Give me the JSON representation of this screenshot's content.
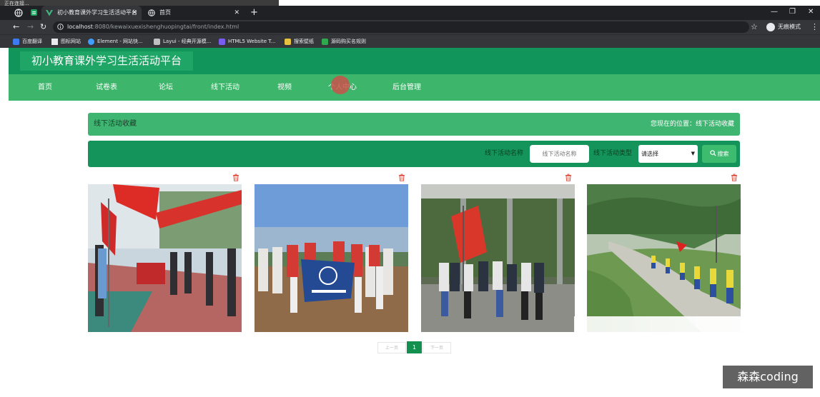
{
  "browser": {
    "status_text": "正在连接...",
    "tabs": [
      {
        "title": "初小教育课外学习生活活动平台",
        "active": true
      },
      {
        "title": "首页",
        "active": false
      }
    ],
    "url_host": "localhost",
    "url_path": ":8080/kewaixuexishenghuopingtai/front/index.html",
    "incognito_label": "无痕模式",
    "bookmarks": [
      "百度翻译",
      "图标网站",
      "Element - 网站快...",
      "Layui - 经典开源模...",
      "HTML5 Website T...",
      "搜索壁纸",
      "源码购买名规则"
    ]
  },
  "site": {
    "title": "初小教育课外学习生活活动平台",
    "nav": [
      "首页",
      "试卷表",
      "论坛",
      "线下活动",
      "视频",
      "个人中心",
      "后台管理"
    ]
  },
  "breadcrumb": {
    "title": "线下活动收藏",
    "location": "您现在的位置：线下活动收藏"
  },
  "search": {
    "name_label": "线下活动名称",
    "name_placeholder": "线下活动名称",
    "type_label": "线下活动类型",
    "select_value": "请选择",
    "button_label": "搜索"
  },
  "cards": [
    {
      "image": "campus-event-red-flags"
    },
    {
      "image": "baseball-team-group-photo"
    },
    {
      "image": "group-photo-with-flag"
    },
    {
      "image": "students-hiking-countryside"
    }
  ],
  "pagination": {
    "prev": "上一页",
    "current": "1",
    "next": "下一页"
  },
  "watermark": "森森coding",
  "colors": {
    "header": "#12955a",
    "nav": "#3db56a",
    "accent": "#13904f",
    "trash_icon": "#e05545"
  }
}
